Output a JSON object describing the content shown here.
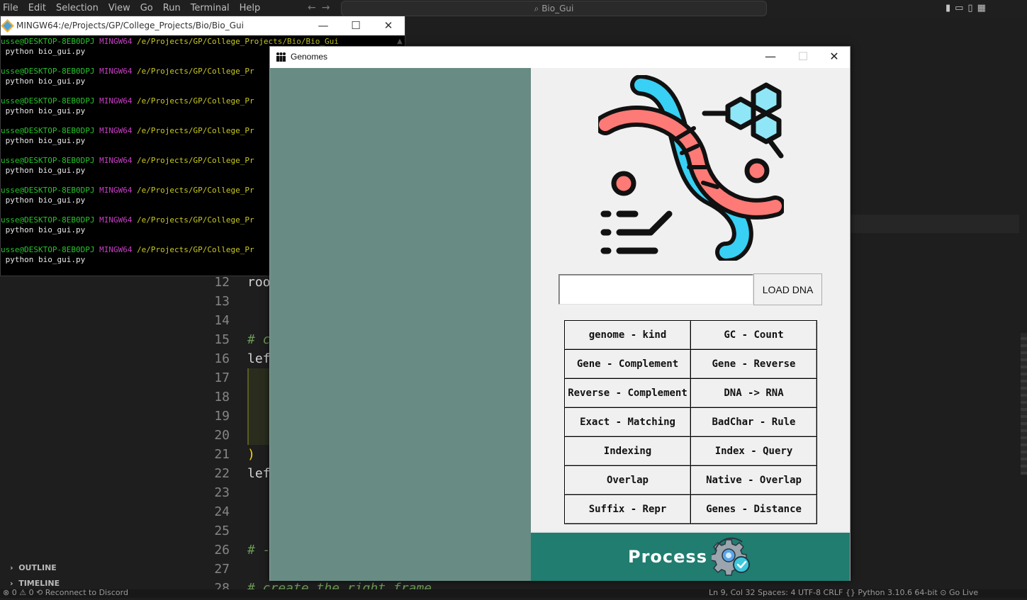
{
  "vscode": {
    "menu": [
      "File",
      "Edit",
      "Selection",
      "View",
      "Go",
      "Run",
      "Terminal",
      "Help"
    ],
    "command_center": "Bio_Gui",
    "code_lines": [
      {
        "n": "12",
        "text": "roo",
        "kind": "normal"
      },
      {
        "n": "13",
        "text": "",
        "kind": "normal"
      },
      {
        "n": "14",
        "text": "",
        "kind": "normal"
      },
      {
        "n": "15",
        "text": "# c",
        "kind": "cmt"
      },
      {
        "n": "16",
        "text": "lef",
        "kind": "normal"
      },
      {
        "n": "17",
        "text": "",
        "kind": "normal"
      },
      {
        "n": "18",
        "text": "",
        "kind": "normal"
      },
      {
        "n": "19",
        "text": "",
        "kind": "normal"
      },
      {
        "n": "20",
        "text": "",
        "kind": "normal"
      },
      {
        "n": "21",
        "text": ")",
        "kind": "brk"
      },
      {
        "n": "22",
        "text": "lef",
        "kind": "normal"
      },
      {
        "n": "23",
        "text": "",
        "kind": "normal"
      },
      {
        "n": "24",
        "text": "",
        "kind": "normal"
      },
      {
        "n": "25",
        "text": "",
        "kind": "normal"
      },
      {
        "n": "26",
        "text": "# -",
        "kind": "cmt"
      },
      {
        "n": "27",
        "text": "",
        "kind": "normal"
      },
      {
        "n": "28",
        "text": "# create the right frame",
        "kind": "cmt"
      }
    ],
    "outline_label": "OUTLINE",
    "timeline_label": "TIMELINE",
    "status_left": "⊗ 0 ⚠ 0   ⟲ Reconnect to Discord",
    "status_right": "Ln 9, Col 32   Spaces: 4   UTF-8   CRLF   {} Python   3.10.6 64-bit   ⊙ Go Live"
  },
  "terminal": {
    "title": "MINGW64:/e/Projects/GP/College_Projects/Bio/Bio_Gui",
    "prompts": [
      {
        "user": "usse@DESKTOP-8EB0DPJ",
        "host": "MINGW64",
        "path": "/e/Projects/GP/College_Projects/Bio/Bio_Gui",
        "cmd": "python bio_gui.py"
      },
      {
        "user": "usse@DESKTOP-8EB0DPJ",
        "host": "MINGW64",
        "path": "/e/Projects/GP/College_Pr",
        "cmd": "python bio_gui.py"
      },
      {
        "user": "usse@DESKTOP-8EB0DPJ",
        "host": "MINGW64",
        "path": "/e/Projects/GP/College_Pr",
        "cmd": "python bio_gui.py"
      },
      {
        "user": "usse@DESKTOP-8EB0DPJ",
        "host": "MINGW64",
        "path": "/e/Projects/GP/College_Pr",
        "cmd": "python bio_gui.py"
      },
      {
        "user": "usse@DESKTOP-8EB0DPJ",
        "host": "MINGW64",
        "path": "/e/Projects/GP/College_Pr",
        "cmd": "python bio_gui.py"
      },
      {
        "user": "usse@DESKTOP-8EB0DPJ",
        "host": "MINGW64",
        "path": "/e/Projects/GP/College_Pr",
        "cmd": "python bio_gui.py"
      },
      {
        "user": "usse@DESKTOP-8EB0DPJ",
        "host": "MINGW64",
        "path": "/e/Projects/GP/College_Pr",
        "cmd": "python bio_gui.py"
      },
      {
        "user": "usse@DESKTOP-8EB0DPJ",
        "host": "MINGW64",
        "path": "/e/Projects/GP/College_Pr",
        "cmd": "python bio_gui.py"
      }
    ]
  },
  "genomes": {
    "title": "Genomes",
    "input_value": "",
    "load_button": "LOAD DNA",
    "operations": [
      "genome - kind",
      "GC - Count",
      "Gene - Complement",
      "Gene - Reverse",
      "Reverse - Complement",
      "DNA -> RNA",
      "Exact - Matching",
      "BadChar - Rule",
      "Indexing",
      "Index - Query",
      "Overlap",
      "Native - Overlap",
      "Suffix - Repr",
      "Genes - Distance"
    ],
    "process_button": "Process",
    "colors": {
      "left_frame": "#688b83",
      "process": "#207d70",
      "dna_red": "#fe7a76",
      "dna_blue": "#38d0f5",
      "hex_fill": "#8fe6f7"
    }
  }
}
